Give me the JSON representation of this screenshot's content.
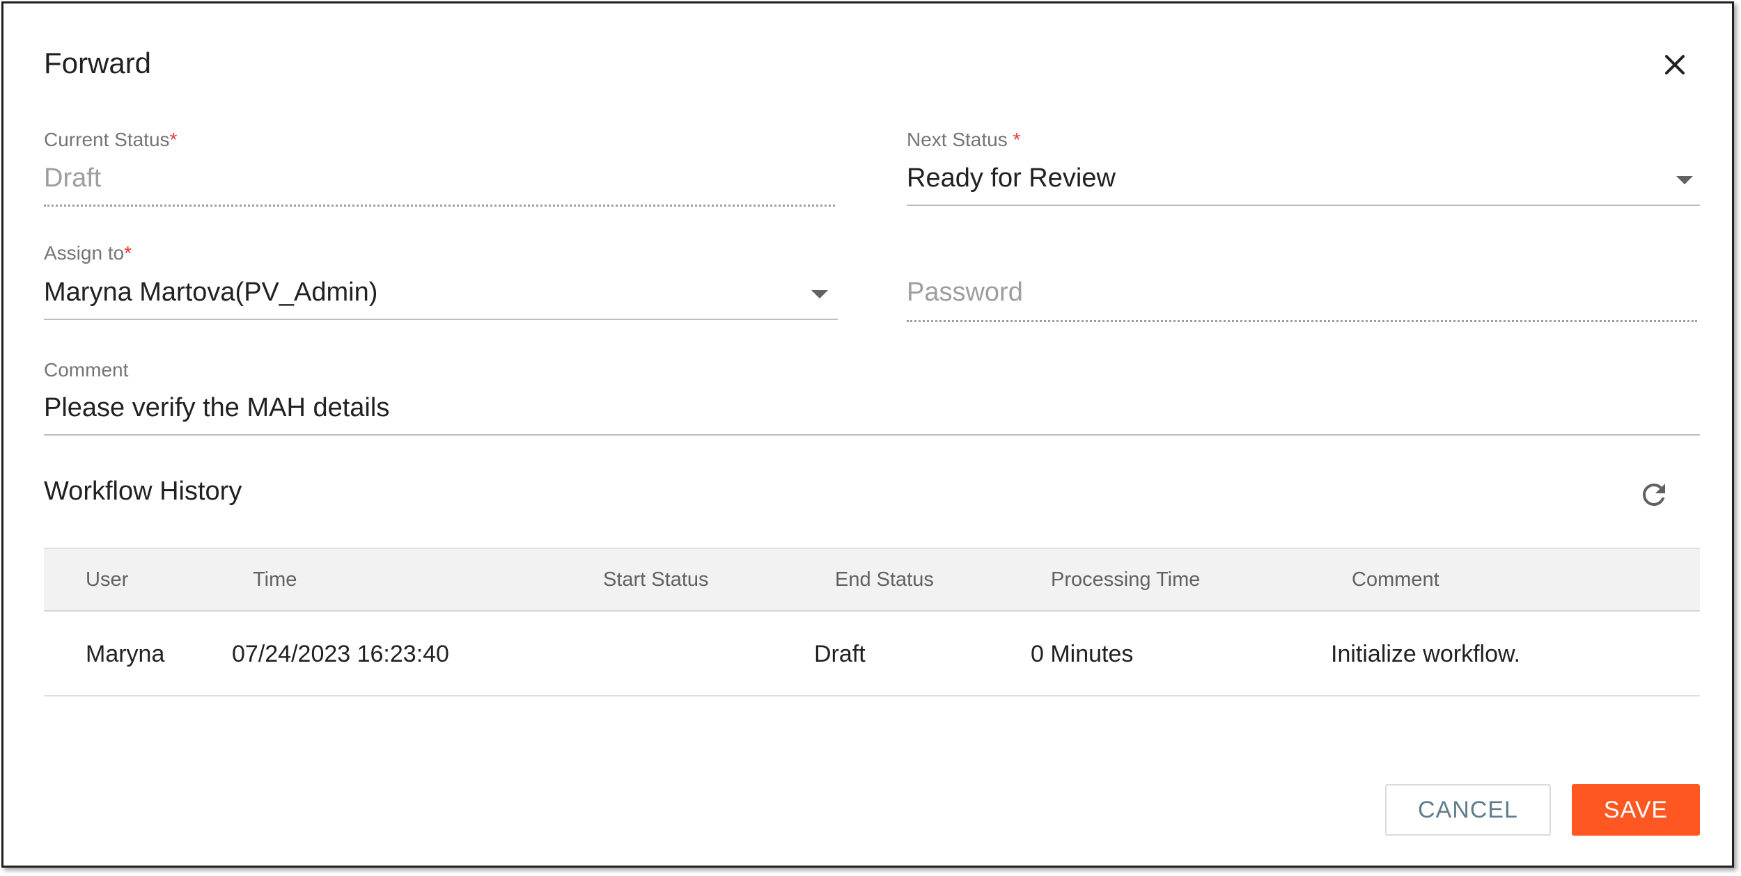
{
  "dialog": {
    "title": "Forward",
    "close_icon": "close-icon"
  },
  "form": {
    "current_status": {
      "label": "Current Status",
      "required_mark": "*",
      "value": "Draft"
    },
    "next_status": {
      "label": "Next Status",
      "required_mark": "*",
      "value": "Ready for Review",
      "icon": "chevron-down-icon"
    },
    "assign_to": {
      "label": "Assign to",
      "required_mark": "*",
      "value": "Maryna Martova(PV_Admin)",
      "icon": "chevron-down-icon"
    },
    "password": {
      "placeholder": "Password",
      "value": ""
    },
    "comment": {
      "label": "Comment",
      "value": "Please verify the MAH details"
    }
  },
  "workflow_history": {
    "title": "Workflow History",
    "refresh_icon": "refresh-icon",
    "columns": [
      "User",
      "Time",
      "Start Status",
      "End Status",
      "Processing Time",
      "Comment"
    ],
    "rows": [
      {
        "user": "Maryna",
        "time": "07/24/2023 16:23:40",
        "start_status": "",
        "end_status": "Draft",
        "processing_time": "0 Minutes",
        "comment": "Initialize workflow."
      }
    ]
  },
  "actions": {
    "cancel_label": "CANCEL",
    "save_label": "SAVE"
  },
  "colors": {
    "accent": "#ff5722",
    "required": "#e53935",
    "cancel_text": "#5f7d8c"
  }
}
